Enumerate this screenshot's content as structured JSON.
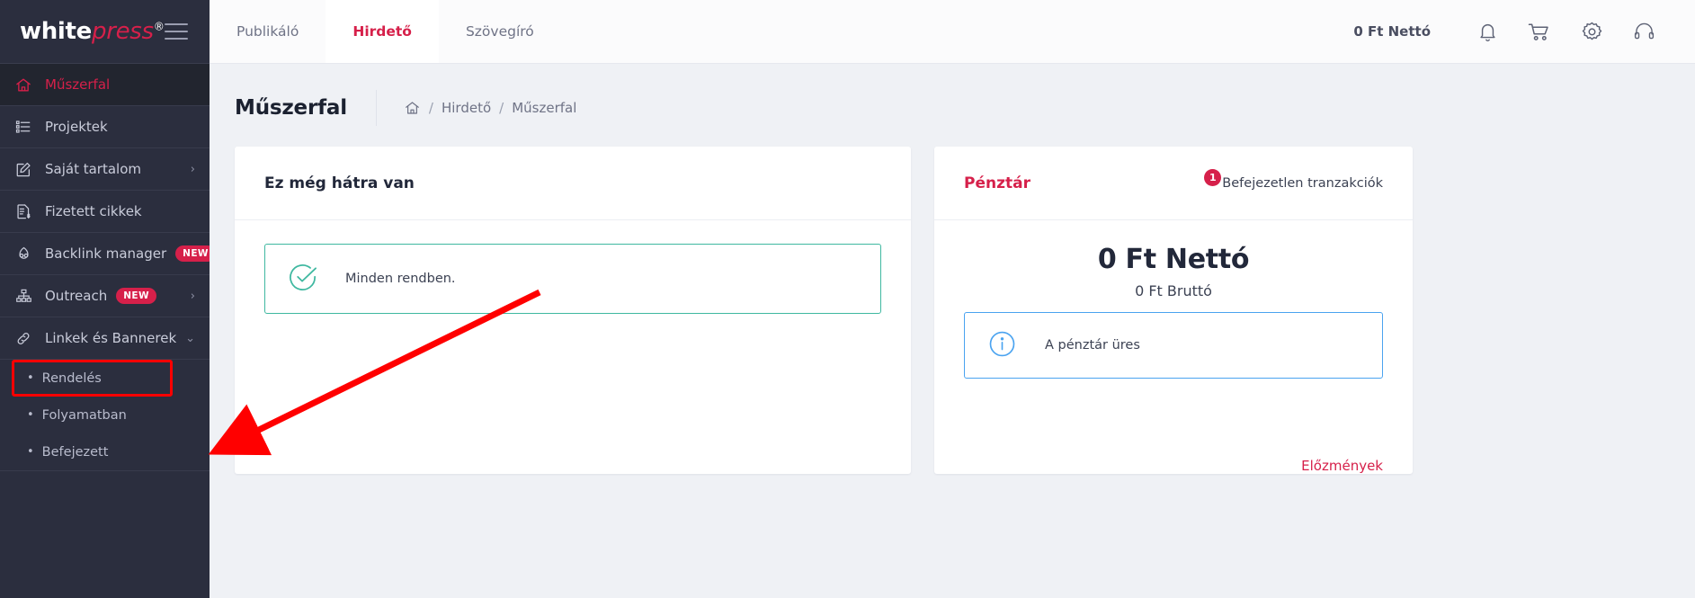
{
  "brand": {
    "part1": "white",
    "part2": "press",
    "reg": "®",
    "menu_icon": "hamburger-icon"
  },
  "sidebar": {
    "items": [
      {
        "label": "Műszerfal",
        "icon": "home-icon",
        "active": true,
        "badge": "",
        "chevron": ""
      },
      {
        "label": "Projektek",
        "icon": "list-icon",
        "active": false,
        "badge": "",
        "chevron": ""
      },
      {
        "label": "Saját tartalom",
        "icon": "edit-document-icon",
        "active": false,
        "badge": "",
        "chevron": "›"
      },
      {
        "label": "Fizetett cikkek",
        "icon": "paid-document-icon",
        "active": false,
        "badge": "",
        "chevron": ""
      },
      {
        "label": "Backlink manager",
        "icon": "backlink-icon",
        "active": false,
        "badge": "NEW",
        "chevron": ""
      },
      {
        "label": "Outreach",
        "icon": "sitemap-icon",
        "active": false,
        "badge": "NEW",
        "chevron": "›"
      },
      {
        "label": "Linkek és Bannerek",
        "icon": "link-icon",
        "active": false,
        "badge": "",
        "chevron": "⌄"
      }
    ],
    "subitems": [
      {
        "label": "Rendelés",
        "highlighted": true
      },
      {
        "label": "Folyamatban",
        "highlighted": false
      },
      {
        "label": "Befejezett",
        "highlighted": false
      }
    ],
    "bullet": "•"
  },
  "topbar": {
    "tabs": [
      {
        "label": "Publikáló",
        "active": false
      },
      {
        "label": "Hirdető",
        "active": true
      },
      {
        "label": "Szövegíró",
        "active": false
      }
    ],
    "balance": "0 Ft Nettó",
    "icons": [
      "bell-icon",
      "cart-icon",
      "gear-icon",
      "headset-icon"
    ]
  },
  "page": {
    "title": "Műszerfal",
    "breadcrumb": {
      "home_icon": "home-icon",
      "sep": "/",
      "items": [
        "Hirdető",
        "Műszerfal"
      ]
    }
  },
  "left_card": {
    "title": "Ez még hátra van",
    "alert": {
      "icon": "check-circle-icon",
      "text": "Minden rendben."
    }
  },
  "right_card": {
    "title": "Pénztár",
    "badge_count": "1",
    "badge_label": "Befejezetlen tranzakciók",
    "amount_net": "0 Ft Nettó",
    "amount_gross": "0 Ft Bruttó",
    "alert": {
      "icon": "info-circle-icon",
      "text": "A pénztár üres"
    },
    "history_link": "Előzmények"
  },
  "colors": {
    "brand_crimson": "#d6204a",
    "sidebar_bg": "#2b2e3e",
    "annotation_red": "#ff0000",
    "success_green": "#3fb8a0",
    "info_blue": "#4aa3f0"
  }
}
